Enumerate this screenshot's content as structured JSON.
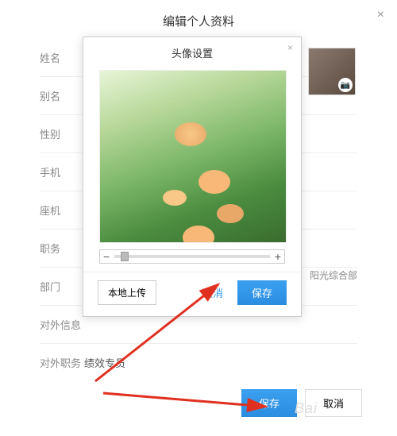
{
  "header": {
    "title": "编辑个人资料"
  },
  "form": {
    "rows": [
      {
        "label": "姓名"
      },
      {
        "label": "别名"
      },
      {
        "label": "性别"
      },
      {
        "label": "手机"
      },
      {
        "label": "座机"
      },
      {
        "label": "职务"
      },
      {
        "label": "部门",
        "value": "阳光综合部"
      },
      {
        "label": "对外信息"
      },
      {
        "label": "对外职务",
        "value": "绩效专员"
      }
    ]
  },
  "dialog": {
    "title": "头像设置",
    "upload": "本地上传",
    "cancel": "取消",
    "save": "保存",
    "minus": "−",
    "plus": "+"
  },
  "footer": {
    "save": "保存",
    "cancel": "取消"
  },
  "watermark": "Bai"
}
